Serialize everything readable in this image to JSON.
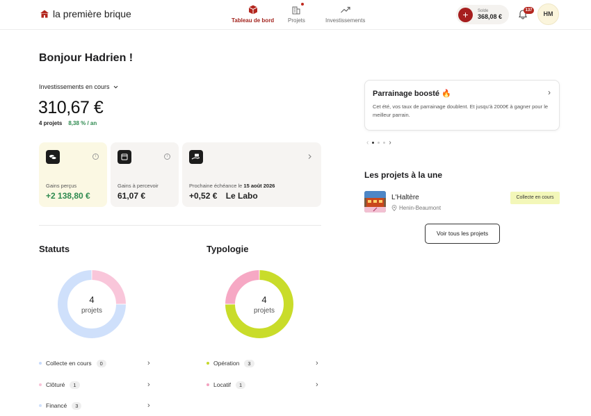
{
  "header": {
    "brand": "la première brique",
    "nav": [
      {
        "label": "Tableau de bord",
        "active": true
      },
      {
        "label": "Projets",
        "active": false
      },
      {
        "label": "Investissements",
        "active": false
      }
    ],
    "balance_caption": "Solde",
    "balance_value": "368,08 €",
    "notifications": "137",
    "avatar_initials": "HM"
  },
  "greeting": "Bonjour Hadrien !",
  "investments": {
    "selector_label": "Investissements en cours",
    "total": "310,67 €",
    "projects": "4 projets",
    "rate": "8,38 % / an"
  },
  "cards": [
    {
      "label": "Gains perçus",
      "value": "+2 138,80 €"
    },
    {
      "label": "Gains à percevoir",
      "value": "61,07 €"
    },
    {
      "label_prefix": "Prochaine échéance le",
      "label_date": "15 août 2026",
      "value": "+0,52 €",
      "project": "Le Labo"
    }
  ],
  "statuts": {
    "title": "Statuts",
    "center_number": "4",
    "center_label": "projets",
    "items": [
      {
        "label": "Collecte en cours",
        "count": "0",
        "color": "#c6dafb"
      },
      {
        "label": "Clôturé",
        "count": "1",
        "color": "#f9c3d8"
      },
      {
        "label": "Financé",
        "count": "3",
        "color": "#cfe0fb"
      }
    ],
    "segments": [
      {
        "label": "Clôturé",
        "value": 1,
        "color": "#f9c6da"
      },
      {
        "label": "Financé",
        "value": 3,
        "color": "#cfe0fb"
      }
    ]
  },
  "typologie": {
    "title": "Typologie",
    "center_number": "4",
    "center_label": "projets",
    "items": [
      {
        "label": "Opération",
        "count": "3",
        "color": "#c5d82b"
      },
      {
        "label": "Locatif",
        "count": "1",
        "color": "#f3a2c0"
      }
    ],
    "segments": [
      {
        "label": "Opération",
        "value": 3,
        "color": "#c9dc2a"
      },
      {
        "label": "Locatif",
        "value": 1,
        "color": "#f6a8c4"
      }
    ]
  },
  "promo": {
    "title": "Parrainage boosté",
    "title_emoji": "🔥",
    "description": "Cet été, vos taux de parrainage doublent. Et jusqu'à 2000€ à gagner pour le meilleur parrain."
  },
  "featured": {
    "title": "Les projets à la une",
    "project_name": "L'Haltère",
    "project_location": "Henin-Beaumont",
    "project_status": "Collecte en cours",
    "see_all": "Voir tous les projets"
  },
  "colors": {
    "brand_red": "#a61e1e",
    "yellow_card": "#fbf8e3",
    "positive_green": "#2e8a4f"
  }
}
